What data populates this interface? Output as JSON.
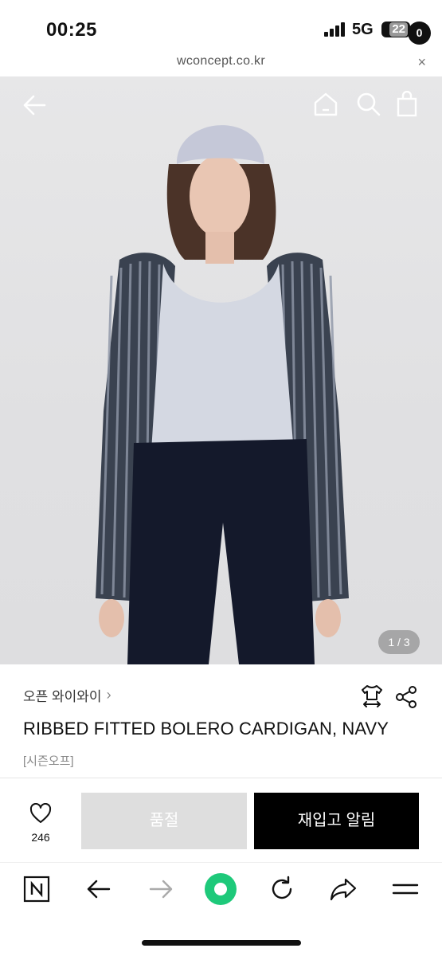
{
  "status_bar": {
    "time": "00:25",
    "network": "5G",
    "battery": "22"
  },
  "url_bar": {
    "url": "wconcept.co.kr",
    "close_label": "×"
  },
  "hero": {
    "page_indicator": "1 / 3",
    "cart_count": "0"
  },
  "product": {
    "brand": "오픈 와이와이",
    "title": "RIBBED FITTED BOLERO CARDIGAN, NAVY",
    "tag": "[시즌오프]"
  },
  "actions": {
    "wish_count": "246",
    "soldout_label": "품절",
    "restock_label": "재입고 알림"
  },
  "colors": {
    "accent_green": "#1ec97a",
    "primary_black": "#000000",
    "disabled_gray": "#dedede"
  },
  "icons": [
    "back-arrow-icon",
    "home-icon",
    "search-icon",
    "shopping-bag-icon",
    "size-guide-icon",
    "share-icon",
    "heart-icon",
    "naver-logo-icon",
    "browser-back-icon",
    "browser-forward-icon",
    "green-circle-icon",
    "refresh-icon",
    "share-arrow-icon",
    "menu-icon"
  ]
}
